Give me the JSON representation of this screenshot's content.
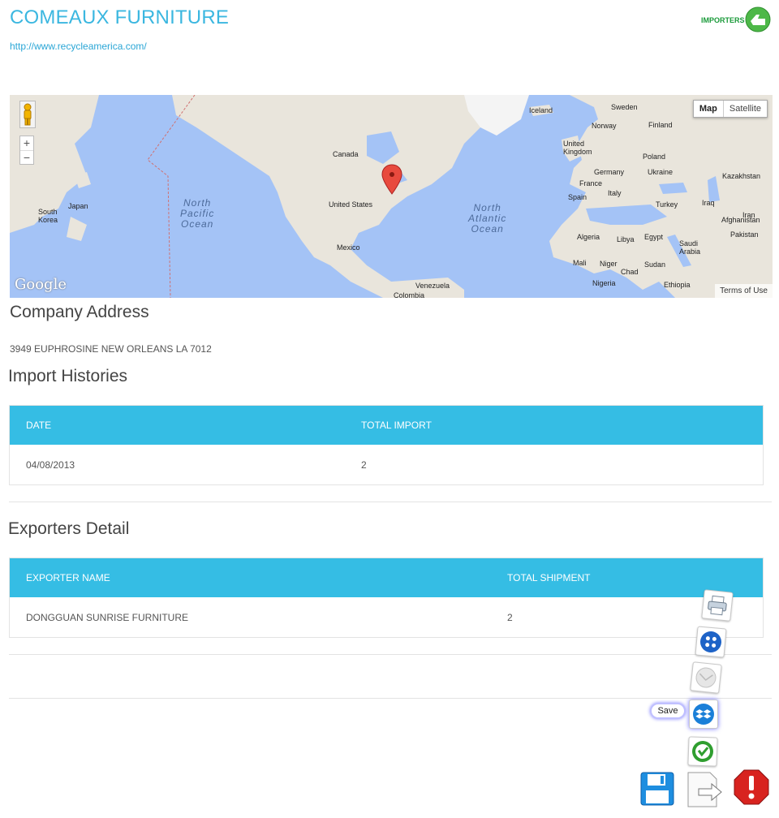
{
  "company": {
    "title": "COMEAUX FURNITURE",
    "url": "http://www.recycleamerica.com/",
    "logo_text": "IMPORTERS"
  },
  "map": {
    "map_type": {
      "active": "Map",
      "inactive": "Satellite"
    },
    "zoom_in": "+",
    "zoom_out": "−",
    "terms": "Terms of Use",
    "brand": "Google",
    "labels": {
      "iceland": "Iceland",
      "sweden": "Sweden",
      "norway": "Norway",
      "finland": "Finland",
      "uk": "United Kingdom",
      "poland": "Poland",
      "germany": "Germany",
      "ukraine": "Ukraine",
      "france": "France",
      "italy": "Italy",
      "spain": "Spain",
      "turkey": "Turkey",
      "kazakhstan": "Kazakhstan",
      "iran": "Iran",
      "afghanistan": "Afghanistan",
      "pakistan": "Pakistan",
      "iraq": "Iraq",
      "saudi": "Saudi Arabia",
      "algeria": "Algeria",
      "libya": "Libya",
      "egypt": "Egypt",
      "mali": "Mali",
      "niger": "Niger",
      "chad": "Chad",
      "sudan": "Sudan",
      "nigeria": "Nigeria",
      "ethiopia": "Ethiopia",
      "canada": "Canada",
      "us": "United States",
      "mexico": "Mexico",
      "venezuela": "Venezuela",
      "colombia": "Colombia",
      "japan": "Japan",
      "south_korea": "South Korea"
    },
    "oceans": {
      "north_pacific": [
        "North",
        "Pacific",
        "Ocean"
      ],
      "north_atlantic": [
        "North",
        "Atlantic",
        "Ocean"
      ]
    }
  },
  "address": {
    "heading": "Company Address",
    "value": "3949 EUPHROSINE NEW ORLEANS LA 7012"
  },
  "import_histories": {
    "heading": "Import Histories",
    "columns": [
      "DATE",
      "TOTAL IMPORT"
    ],
    "rows": [
      [
        "04/08/2013",
        "2"
      ]
    ]
  },
  "exporters": {
    "heading": "Exporters Detail",
    "columns": [
      "EXPORTER NAME",
      "TOTAL SHIPMENT"
    ],
    "rows": [
      [
        "DONGGUAN SUNRISE FURNITURE",
        "2"
      ]
    ]
  },
  "toolbar": {
    "save_tooltip": "Save"
  }
}
